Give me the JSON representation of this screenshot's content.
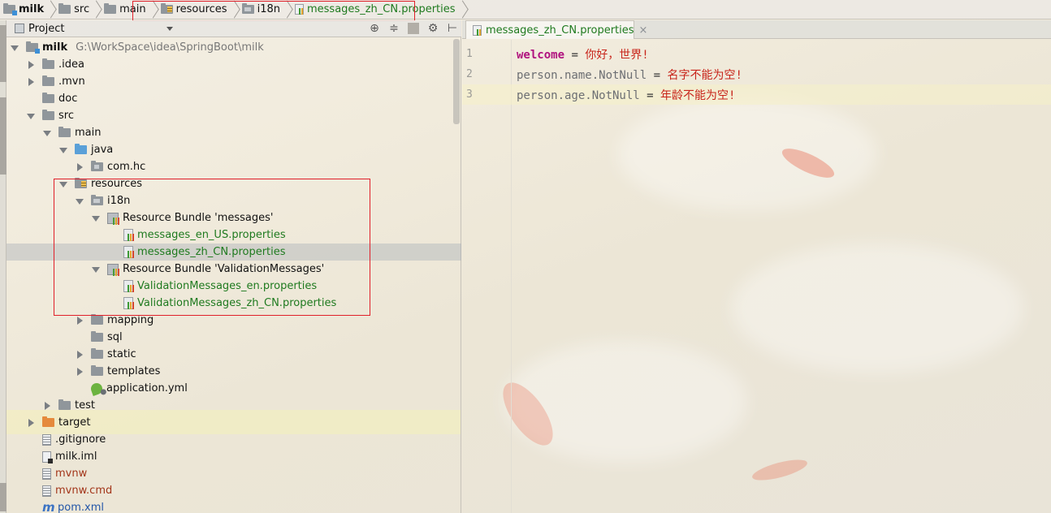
{
  "breadcrumb": [
    {
      "label": "milk",
      "icon": "module-folder-icon"
    },
    {
      "label": "src",
      "icon": "folder-icon"
    },
    {
      "label": "main",
      "icon": "folder-icon"
    },
    {
      "label": "resources",
      "icon": "resources-folder-icon"
    },
    {
      "label": "i18n",
      "icon": "folder-icon"
    },
    {
      "label": "messages_zh_CN.properties",
      "icon": "properties-file-icon"
    }
  ],
  "project_panel": {
    "title": "Project",
    "tools": [
      "target-icon",
      "collapse-icon",
      "gear-icon",
      "hide-icon"
    ]
  },
  "tree": [
    {
      "label": "milk",
      "path": "G:\\WorkSpace\\idea\\SpringBoot\\milk"
    },
    {
      "label": ".idea"
    },
    {
      "label": ".mvn"
    },
    {
      "label": "doc"
    },
    {
      "label": "src"
    },
    {
      "label": "main"
    },
    {
      "label": "java"
    },
    {
      "label": "com.hc"
    },
    {
      "label": "resources"
    },
    {
      "label": "i18n"
    },
    {
      "label": "Resource Bundle 'messages'"
    },
    {
      "label": "messages_en_US.properties"
    },
    {
      "label": "messages_zh_CN.properties"
    },
    {
      "label": "Resource Bundle 'ValidationMessages'"
    },
    {
      "label": "ValidationMessages_en.properties"
    },
    {
      "label": "ValidationMessages_zh_CN.properties"
    },
    {
      "label": "mapping"
    },
    {
      "label": "sql"
    },
    {
      "label": "static"
    },
    {
      "label": "templates"
    },
    {
      "label": "application.yml"
    },
    {
      "label": "test"
    },
    {
      "label": "target"
    },
    {
      "label": ".gitignore"
    },
    {
      "label": "milk.iml"
    },
    {
      "label": "mvnw"
    },
    {
      "label": "mvnw.cmd"
    },
    {
      "label": "pom.xml"
    }
  ],
  "editor": {
    "tab_label": "messages_zh_CN.properties",
    "tab_close": "×",
    "lines": [
      {
        "num": "1",
        "key": "welcome",
        "eq": " = ",
        "value": "你好，世界!"
      },
      {
        "num": "2",
        "key": "person.name.NotNull",
        "eq": " = ",
        "value": "名字不能为空!"
      },
      {
        "num": "3",
        "key": "person.age.NotNull",
        "eq": " = ",
        "value": "年龄不能为空!"
      }
    ]
  },
  "colors": {
    "highlight_box": "#e0202a",
    "green_file": "#1f7a1f",
    "property_key_bold": "#b0127e",
    "property_value": "#c8241a"
  }
}
